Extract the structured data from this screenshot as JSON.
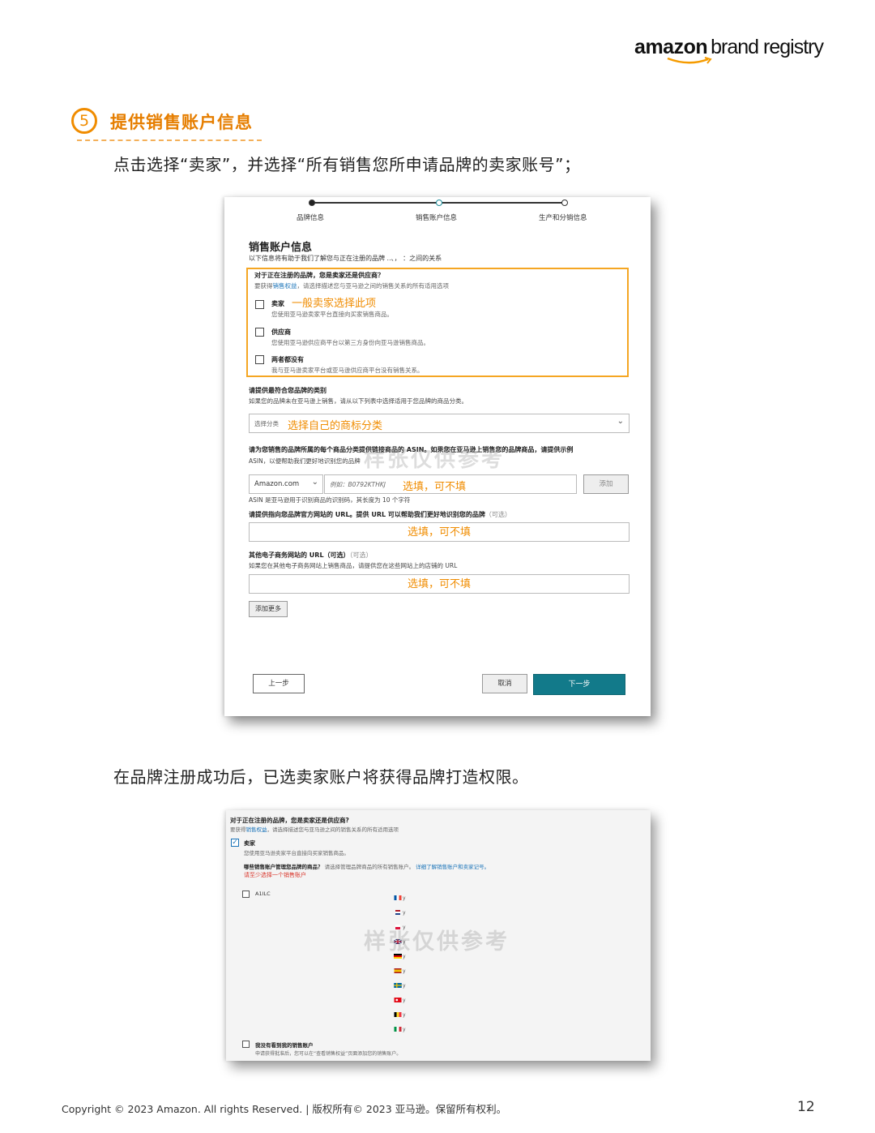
{
  "logo": {
    "amazon": "amazon",
    "brand": "brand registry"
  },
  "section": {
    "number": "5",
    "title": "提供销售账户信息",
    "intro": "点击选择“卖家”，并选择“所有销售您所申请品牌的卖家账号”；",
    "intro2": "在品牌注册成功后，已选卖家账户将获得品牌打造权限。"
  },
  "shot1": {
    "steps": [
      "品牌信息",
      "销售账户信息",
      "生产和分销信息"
    ],
    "title": "销售账户信息",
    "subtitle": "以下信息将有助于我们了解您与正在注册的品牌 ..、， ：之间的关系",
    "question": "对于正在注册的品牌，您是卖家还是供应商？",
    "question_desc_pre": "要获得",
    "question_desc_link": "销售权益",
    "question_desc_post": "，请选择描述您与亚马逊之间的销售关系的所有适用选项",
    "options": [
      {
        "label": "卖家",
        "desc": "您使用亚马逊卖家平台直接向买家销售商品。",
        "note": "一般卖家选择此项"
      },
      {
        "label": "供应商",
        "desc": "您使用亚马逊供应商平台以第三方身份向亚马逊销售商品。",
        "note": ""
      },
      {
        "label": "两者都没有",
        "desc": "我与亚马逊卖家平台或亚马逊供应商平台没有销售关系。",
        "note": ""
      }
    ],
    "category_title": "请提供最符合您品牌的类别",
    "category_desc": "如果您的品牌未在亚马逊上销售，请从以下列表中选择适用于您品牌的商品分类。",
    "category_placeholder": "选择分类",
    "category_note": "选择自己的商标分类",
    "asin_title": "请为您销售的品牌所属的每个商品分类提供链接商品的 ASIN。如果您在亚马逊上销售您的品牌商品，请提供示例",
    "asin_title2": "ASIN，以便帮助我们更好地识别您的品牌",
    "marketplace": "Amazon.com",
    "asin_placeholder": "例如：B0792KTHKJ",
    "optional_note": "选填，可不填",
    "add_button": "添加",
    "asin_hint": "ASIN 是亚马逊用于识别商品的识别码，其长度为 10 个字符",
    "url_title": "请提供指向您品牌官方网站的 URL。提供 URL 可以帮助我们更好地识别您的品牌",
    "optional": "（可选）",
    "ecom_title": "其他电子商务网站的 URL（可选）",
    "ecom_desc": "如果您在其他电子商务网站上销售商品，请提供您在这些网站上的店铺的 URL",
    "add_more": "添加更多",
    "back": "上一步",
    "cancel": "取消",
    "next": "下一步",
    "watermark": "样张仅供参考"
  },
  "shot2": {
    "question": "对于正在注册的品牌，您是卖家还是供应商?",
    "question_desc_pre": "要获得",
    "question_desc_link": "销售权益",
    "question_desc_post": "，请选择描述您与亚马逊之间的销售关系的所有适用选项",
    "seller_label": "卖家",
    "seller_desc": "您使用亚马逊卖家平台直接向买家销售商品。",
    "accounts_q": "哪些销售账户管理您品牌的商品？",
    "accounts_desc": "请选择管理品牌商品的所有销售账户。",
    "accounts_link": "详细了解销售账户和卖家记号。",
    "accounts_warn": "请至少选择一个销售账户",
    "account_name": "A1ILC",
    "flag_text": "y",
    "none_label": "我没有看到我的销售账户",
    "none_desc": "申请获得批准后，您可以在“查看销售权益”页面添加您的销售账户。",
    "watermark": "样张仅供参考"
  },
  "footer": {
    "copyright": "Copyright © 2023 Amazon. All rights Reserved. | 版权所有© 2023 亚马逊。保留所有权利。",
    "page": "12"
  }
}
